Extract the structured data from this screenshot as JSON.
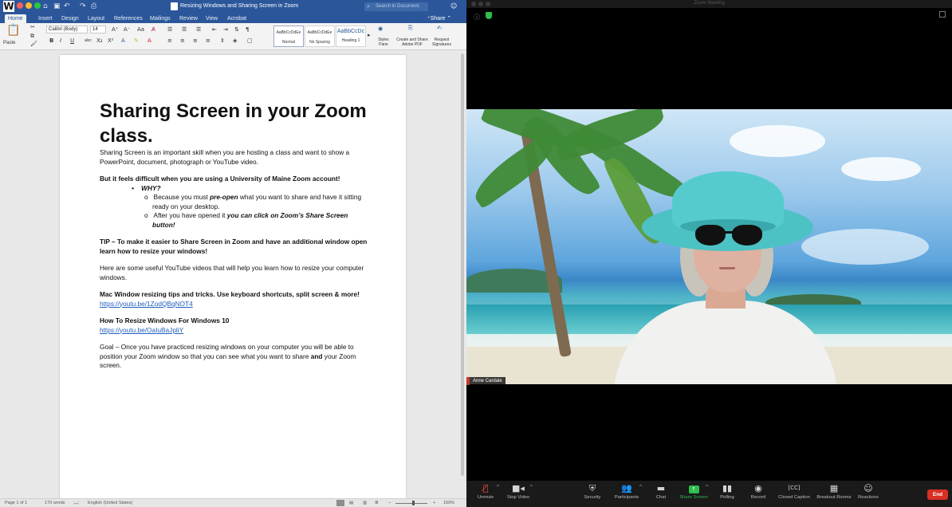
{
  "word": {
    "title": "Resizing Windows and Sharing Screen in Zoom",
    "search_placeholder": "Search in Document",
    "tabs": [
      "Home",
      "Insert",
      "Design",
      "Layout",
      "References",
      "Mailings",
      "Review",
      "View",
      "Acrobat"
    ],
    "share_label": "Share",
    "ribbon": {
      "paste_label": "Paste",
      "font_name": "Calibri (Body)",
      "font_size": "14",
      "styles": [
        {
          "preview": "AaBbCcDdEe",
          "name": "Normal"
        },
        {
          "preview": "AaBbCcDdEe",
          "name": "No Spacing"
        },
        {
          "preview": "AaBbCcDc",
          "name": "Heading 1"
        }
      ],
      "styles_pane_label": "Styles Pane",
      "create_share_label": "Create and Share Adobe PDF",
      "request_signatures_label": "Request Signatures"
    },
    "document": {
      "heading": "Sharing Screen in your Zoom class.",
      "intro": "Sharing Screen is an important skill when you are hosting a class and want to show a PowerPoint, document, photograph or YouTube video.",
      "difficulty": "But it feels difficult when you are using a University of Maine Zoom account!",
      "why": "WHY?",
      "reason1_pre": "Because you must ",
      "reason1_em": "pre-open",
      "reason1_post": " what you want to share and have it sitting ready on your desktop.",
      "reason2_pre": "After you have opened it ",
      "reason2_em": "you can click on Zoom’s Share Screen button!",
      "tip": "TIP – To make it easier to Share Screen in Zoom and have an additional window open learn how to resize your windows!",
      "videos_intro": "Here are some useful YouTube videos that will help you learn how to resize your computer windows.",
      "mac_title": "Mac Window resizing tips and tricks. Use keyboard shortcuts, split screen & more!",
      "mac_link": "https://youtu.be/1ZodQBqNOT4",
      "win_title": "How To Resize Windows For Windows 10",
      "win_link": "https://youtu.be/OaIuBaJpliY",
      "goal_pre": "Goal – Once you have practiced resizing windows on your computer you will be able to position your Zoom window so that you can see what you want to share ",
      "goal_bold": "and",
      "goal_post": " your Zoom screen."
    },
    "status": {
      "page": "Page 1 of 1",
      "words": "170 words",
      "language": "English (United States)",
      "zoom": "150%"
    }
  },
  "zoom": {
    "window_title": "Zoom Meeting",
    "participant_name": "Anne Cardale",
    "toolbar": [
      {
        "label": "Unmute",
        "icon": "microphone-muted-icon"
      },
      {
        "label": "Stop Video",
        "icon": "video-camera-icon"
      },
      {
        "label": "Security",
        "icon": "shield-icon"
      },
      {
        "label": "Participants",
        "icon": "participants-icon"
      },
      {
        "label": "Chat",
        "icon": "chat-icon"
      },
      {
        "label": "Share Screen",
        "icon": "share-screen-icon"
      },
      {
        "label": "Polling",
        "icon": "polling-icon"
      },
      {
        "label": "Record",
        "icon": "record-icon"
      },
      {
        "label": "Closed Caption",
        "icon": "closed-caption-icon"
      },
      {
        "label": "Breakout Rooms",
        "icon": "breakout-rooms-icon"
      },
      {
        "label": "Reactions",
        "icon": "reactions-icon"
      }
    ],
    "end_label": "End",
    "colors": {
      "share_green": "#2dbd4c",
      "end_red": "#d93025",
      "word_blue": "#2b579a"
    }
  }
}
